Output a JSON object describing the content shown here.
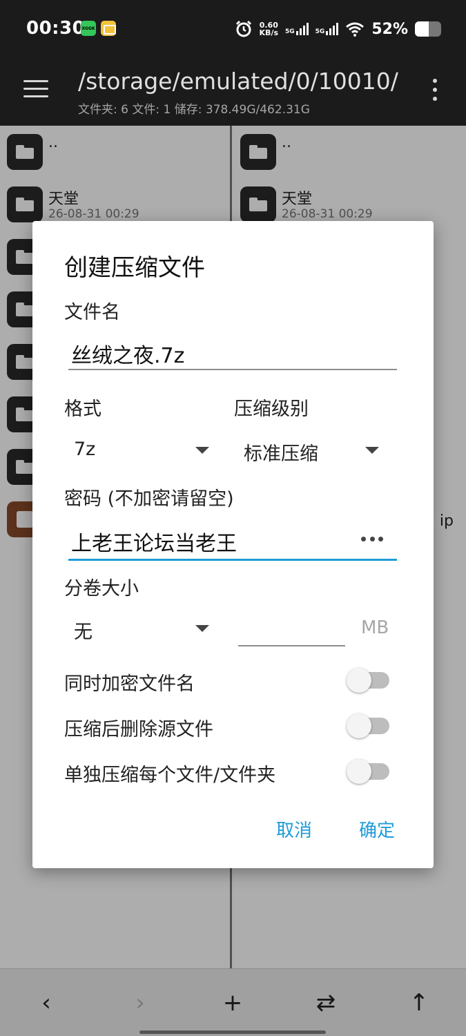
{
  "status_bar": {
    "time": "00:30",
    "app_icon_1": "xbox-like-app-icon",
    "app_icon_1_text": "XGGK",
    "app_icon_2": "wallet-app-icon",
    "alarm_icon": "alarm-clock-icon",
    "speed_value": "0.60",
    "speed_unit": "KB/s",
    "signal_1_label": "5G",
    "signal_2_label": "5G",
    "wifi_icon": "wifi-icon",
    "battery_percent": 52,
    "battery_text": "52%"
  },
  "toolbar": {
    "path": "/storage/emulated/0/10010/",
    "stats": "文件夹: 6  文件: 1  储存: 378.49G/462.31G"
  },
  "left_pane": {
    "rows": [
      {
        "name": "..",
        "date": "",
        "type": "folder"
      },
      {
        "name": "天堂",
        "date": "26-08-31 00:29",
        "type": "folder"
      },
      {
        "name": "",
        "date": "",
        "type": "folder"
      },
      {
        "name": "",
        "date": "",
        "type": "folder"
      },
      {
        "name": "",
        "date": "",
        "type": "folder"
      },
      {
        "name": "",
        "date": "",
        "type": "folder"
      },
      {
        "name": "",
        "date": "",
        "type": "folder"
      },
      {
        "name": "",
        "date": "",
        "type": "archive"
      }
    ]
  },
  "right_pane": {
    "rows": [
      {
        "name": "..",
        "date": "",
        "type": "folder"
      },
      {
        "name": "天堂",
        "date": "26-08-31 00:29",
        "type": "folder"
      }
    ],
    "archive_ext": "ip"
  },
  "dialog": {
    "title": "创建压缩文件",
    "filename_label": "文件名",
    "filename_value": "丝绒之夜.7z",
    "format_label": "格式",
    "format_value": "7z",
    "level_label": "压缩级别",
    "level_value": "标准压缩",
    "password_label": "密码 (不加密请留空)",
    "password_value": "上老王论坛当老王",
    "volume_label": "分卷大小",
    "volume_value": "无",
    "volume_size_value": "",
    "volume_unit": "MB",
    "toggles": [
      {
        "label": "同时加密文件名",
        "on": false
      },
      {
        "label": "压缩后删除源文件",
        "on": false
      },
      {
        "label": "单独压缩每个文件/文件夹",
        "on": false
      }
    ],
    "cancel_label": "取消",
    "ok_label": "确定",
    "accent_color": "#1e9bd7"
  },
  "bottom_nav": {
    "back": "‹",
    "forward": "›",
    "add": "+",
    "swap": "⇄",
    "up": "↑"
  }
}
